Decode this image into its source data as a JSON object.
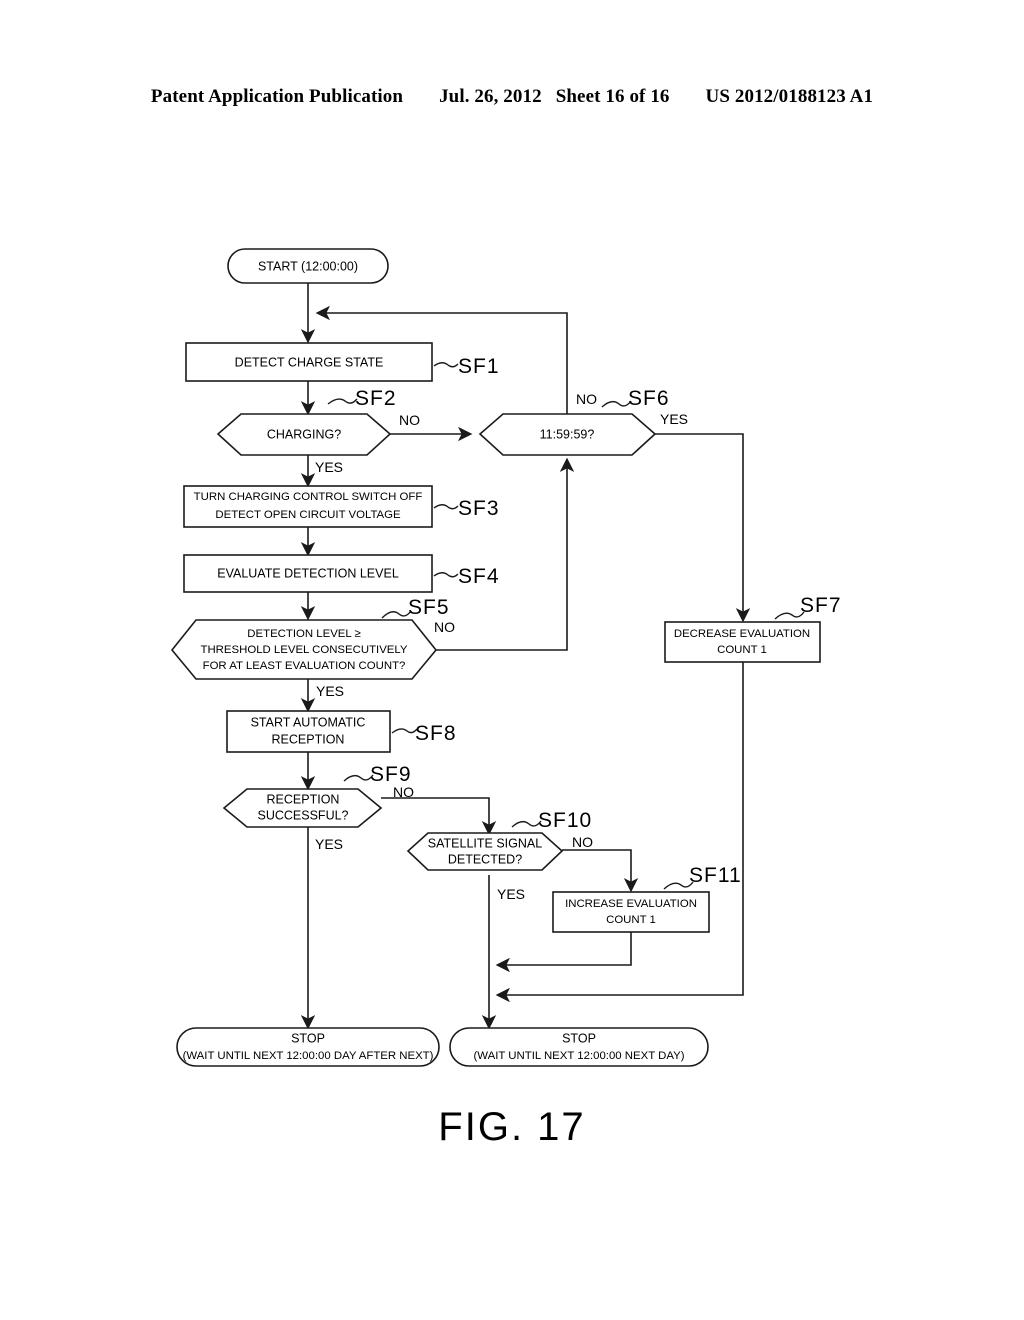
{
  "header": {
    "publication": "Patent Application Publication",
    "date": "Jul. 26, 2012",
    "sheet": "Sheet 16 of 16",
    "docnum": "US 2012/0188123 A1"
  },
  "figure": {
    "caption": "FIG. 17"
  },
  "nodes": {
    "start": {
      "id": "",
      "text_1": "START (12:00:00)",
      "text_2": ""
    },
    "sf1": {
      "id": "SF1",
      "text_1": "DETECT CHARGE STATE",
      "text_2": ""
    },
    "sf2": {
      "id": "SF2",
      "text_1": "CHARGING?",
      "text_2": ""
    },
    "sf3": {
      "id": "SF3",
      "text_1": "TURN CHARGING CONTROL SWITCH OFF",
      "text_2": "DETECT OPEN CIRCUIT VOLTAGE"
    },
    "sf4": {
      "id": "SF4",
      "text_1": "EVALUATE DETECTION LEVEL",
      "text_2": ""
    },
    "sf5": {
      "id": "SF5",
      "text_1": "DETECTION LEVEL ≥",
      "text_2": "THRESHOLD LEVEL CONSECUTIVELY",
      "text_3": "FOR AT LEAST EVALUATION COUNT?"
    },
    "sf6": {
      "id": "SF6",
      "text_1": "11:59:59?",
      "text_2": ""
    },
    "sf7": {
      "id": "SF7",
      "text_1": "DECREASE EVALUATION",
      "text_2": "COUNT 1"
    },
    "sf8": {
      "id": "SF8",
      "text_1": "START AUTOMATIC",
      "text_2": "RECEPTION"
    },
    "sf9": {
      "id": "SF9",
      "text_1": "RECEPTION",
      "text_2": "SUCCESSFUL?"
    },
    "sf10": {
      "id": "SF10",
      "text_1": "SATELLITE SIGNAL",
      "text_2": "DETECTED?"
    },
    "sf11": {
      "id": "SF11",
      "text_1": "INCREASE EVALUATION",
      "text_2": "COUNT 1"
    },
    "stop_left": {
      "id": "",
      "text_1": "STOP",
      "text_2": "(WAIT UNTIL NEXT 12:00:00 DAY AFTER NEXT)"
    },
    "stop_right": {
      "id": "",
      "text_1": "STOP",
      "text_2": "(WAIT UNTIL NEXT 12:00:00 NEXT DAY)"
    }
  },
  "edge_labels": {
    "sf2_no": "NO",
    "sf2_yes": "YES",
    "sf5_no": "NO",
    "sf5_yes": "YES",
    "sf6_no": "NO",
    "sf6_yes": "YES",
    "sf9_no": "NO",
    "sf9_yes": "YES",
    "sf10_no": "NO",
    "sf10_yes": "YES"
  },
  "colors": {
    "stroke": "#1a1a1a",
    "background": "#ffffff",
    "text": "#000000"
  }
}
